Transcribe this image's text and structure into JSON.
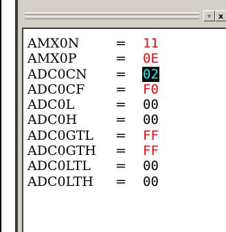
{
  "colors": {
    "changed": "#ff0000",
    "normal": "#000000",
    "selected_bg": "#000000",
    "selected_fg": "#00ffff"
  },
  "titlebar": {
    "dropdown_icon": "chevron-down-icon",
    "close_icon": "close-icon",
    "close_glyph": "x",
    "dropdown_glyph": "▾"
  },
  "registers": [
    {
      "name": "AMX0N",
      "eq": "=",
      "value": "11",
      "state": "changed"
    },
    {
      "name": "AMX0P",
      "eq": "=",
      "value": "0E",
      "state": "changed"
    },
    {
      "name": "ADC0CN",
      "eq": "=",
      "value": "02",
      "state": "selected"
    },
    {
      "name": "ADC0CF",
      "eq": "=",
      "value": "F0",
      "state": "changed"
    },
    {
      "name": "ADC0L",
      "eq": "=",
      "value": "00",
      "state": "normal"
    },
    {
      "name": "ADC0H",
      "eq": "=",
      "value": "00",
      "state": "normal"
    },
    {
      "name": "ADC0GTL",
      "eq": "=",
      "value": "FF",
      "state": "changed"
    },
    {
      "name": "ADC0GTH",
      "eq": "=",
      "value": "FF",
      "state": "changed"
    },
    {
      "name": "ADC0LTL",
      "eq": "=",
      "value": "00",
      "state": "normal"
    },
    {
      "name": "ADC0LTH",
      "eq": "=",
      "value": "00",
      "state": "normal"
    }
  ]
}
